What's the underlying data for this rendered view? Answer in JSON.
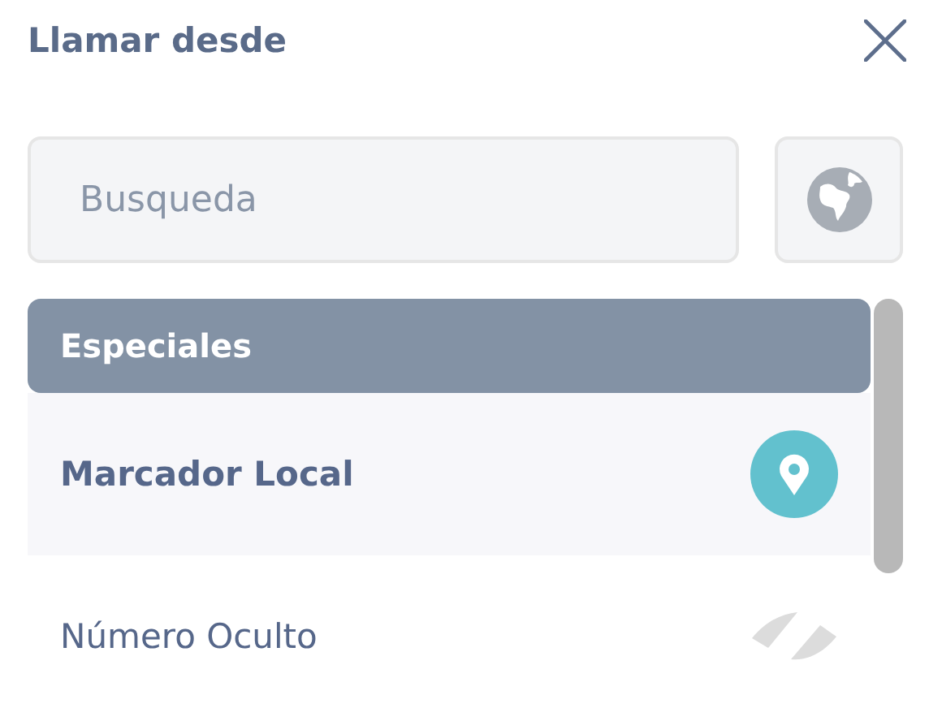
{
  "dialog": {
    "title": "Llamar desde"
  },
  "search": {
    "placeholder": "Busqueda"
  },
  "section": {
    "title": "Especiales"
  },
  "items": [
    {
      "label": "Marcador Local",
      "selected": true,
      "kind": "pin"
    },
    {
      "label": "Número Oculto",
      "selected": false,
      "kind": "hidden"
    }
  ]
}
